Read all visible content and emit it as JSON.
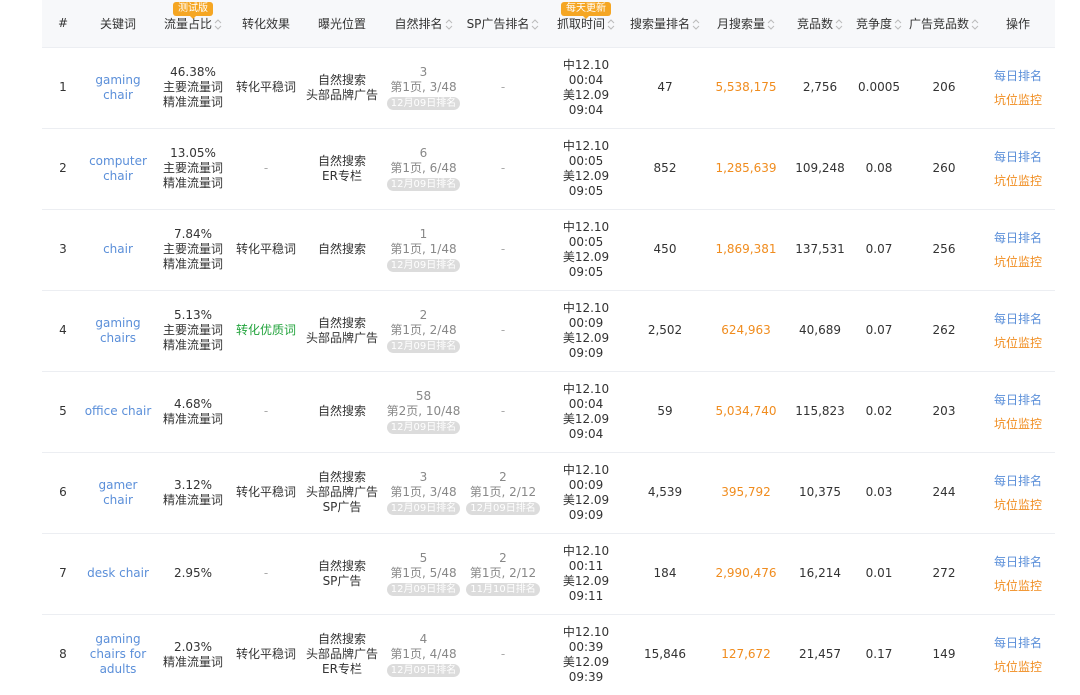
{
  "header": {
    "cols": [
      "#",
      "关键词",
      "流量占比",
      "转化效果",
      "曝光位置",
      "自然排名",
      "SP广告排名",
      "抓取时间",
      "搜索量排名",
      "月搜索量",
      "竞品数",
      "竞争度",
      "广告竞品数",
      "操作"
    ],
    "badge_test": "测试版",
    "badge_daily": "每天更新"
  },
  "actions": {
    "daily_rank": "每日排名",
    "slot_monitor": "坑位监控"
  },
  "rows": [
    {
      "idx": "1",
      "kw": [
        "gaming",
        "chair"
      ],
      "pct": "46.38%",
      "tags": [
        "主要流量词",
        "精准流量词"
      ],
      "conv": "转化平稳词",
      "convType": "normal",
      "pos": [
        "自然搜索",
        "头部品牌广告"
      ],
      "nr": "3",
      "np": "第1页, 3/48",
      "nd": "12月09日排名",
      "sr": "",
      "sp": "",
      "sd": "",
      "t1": "中12.10 00:04",
      "t2": "美12.09 09:04",
      "rank": "47",
      "vol": "5,538,175",
      "comp": "2,756",
      "deg": "0.0005",
      "adc": "206"
    },
    {
      "idx": "2",
      "kw": [
        "computer",
        "chair"
      ],
      "pct": "13.05%",
      "tags": [
        "主要流量词",
        "精准流量词"
      ],
      "conv": "",
      "convType": "none",
      "pos": [
        "自然搜索",
        "ER专栏"
      ],
      "nr": "6",
      "np": "第1页, 6/48",
      "nd": "12月09日排名",
      "sr": "",
      "sp": "",
      "sd": "",
      "t1": "中12.10 00:05",
      "t2": "美12.09 09:05",
      "rank": "852",
      "vol": "1,285,639",
      "comp": "109,248",
      "deg": "0.08",
      "adc": "260"
    },
    {
      "idx": "3",
      "kw": [
        "chair"
      ],
      "pct": "7.84%",
      "tags": [
        "主要流量词",
        "精准流量词"
      ],
      "conv": "转化平稳词",
      "convType": "normal",
      "pos": [
        "自然搜索"
      ],
      "nr": "1",
      "np": "第1页, 1/48",
      "nd": "12月09日排名",
      "sr": "",
      "sp": "",
      "sd": "",
      "t1": "中12.10 00:05",
      "t2": "美12.09 09:05",
      "rank": "450",
      "vol": "1,869,381",
      "comp": "137,531",
      "deg": "0.07",
      "adc": "256"
    },
    {
      "idx": "4",
      "kw": [
        "gaming",
        "chairs"
      ],
      "pct": "5.13%",
      "tags": [
        "主要流量词",
        "精准流量词"
      ],
      "conv": "转化优质词",
      "convType": "good",
      "pos": [
        "自然搜索",
        "头部品牌广告"
      ],
      "nr": "2",
      "np": "第1页, 2/48",
      "nd": "12月09日排名",
      "sr": "",
      "sp": "",
      "sd": "",
      "t1": "中12.10 00:09",
      "t2": "美12.09 09:09",
      "rank": "2,502",
      "vol": "624,963",
      "comp": "40,689",
      "deg": "0.07",
      "adc": "262"
    },
    {
      "idx": "5",
      "kw": [
        "office chair"
      ],
      "pct": "4.68%",
      "tags": [
        "精准流量词"
      ],
      "conv": "",
      "convType": "none",
      "pos": [
        "自然搜索"
      ],
      "nr": "58",
      "np": "第2页, 10/48",
      "nd": "12月09日排名",
      "sr": "",
      "sp": "",
      "sd": "",
      "t1": "中12.10 00:04",
      "t2": "美12.09 09:04",
      "rank": "59",
      "vol": "5,034,740",
      "comp": "115,823",
      "deg": "0.02",
      "adc": "203"
    },
    {
      "idx": "6",
      "kw": [
        "gamer chair"
      ],
      "pct": "3.12%",
      "tags": [
        "精准流量词"
      ],
      "conv": "转化平稳词",
      "convType": "normal",
      "pos": [
        "自然搜索",
        "头部品牌广告",
        "SP广告"
      ],
      "nr": "3",
      "np": "第1页, 3/48",
      "nd": "12月09日排名",
      "sr": "2",
      "sp": "第1页, 2/12",
      "sd": "12月09日排名",
      "t1": "中12.10 00:09",
      "t2": "美12.09 09:09",
      "rank": "4,539",
      "vol": "395,792",
      "comp": "10,375",
      "deg": "0.03",
      "adc": "244"
    },
    {
      "idx": "7",
      "kw": [
        "desk chair"
      ],
      "pct": "2.95%",
      "tags": [],
      "conv": "",
      "convType": "none",
      "pos": [
        "自然搜索",
        "SP广告"
      ],
      "nr": "5",
      "np": "第1页, 5/48",
      "nd": "12月09日排名",
      "sr": "2",
      "sp": "第1页, 2/12",
      "sd": "11月10日排名",
      "t1": "中12.10 00:11",
      "t2": "美12.09 09:11",
      "rank": "184",
      "vol": "2,990,476",
      "comp": "16,214",
      "deg": "0.01",
      "adc": "272"
    },
    {
      "idx": "8",
      "kw": [
        "gaming",
        "chairs for",
        "adults"
      ],
      "pct": "2.03%",
      "tags": [
        "精准流量词"
      ],
      "conv": "转化平稳词",
      "convType": "normal",
      "pos": [
        "自然搜索",
        "头部品牌广告",
        "ER专栏"
      ],
      "nr": "4",
      "np": "第1页, 4/48",
      "nd": "12月09日排名",
      "sr": "",
      "sp": "",
      "sd": "",
      "t1": "中12.10 00:39",
      "t2": "美12.09 09:39",
      "rank": "15,846",
      "vol": "127,672",
      "comp": "21,457",
      "deg": "0.17",
      "adc": "149"
    }
  ]
}
